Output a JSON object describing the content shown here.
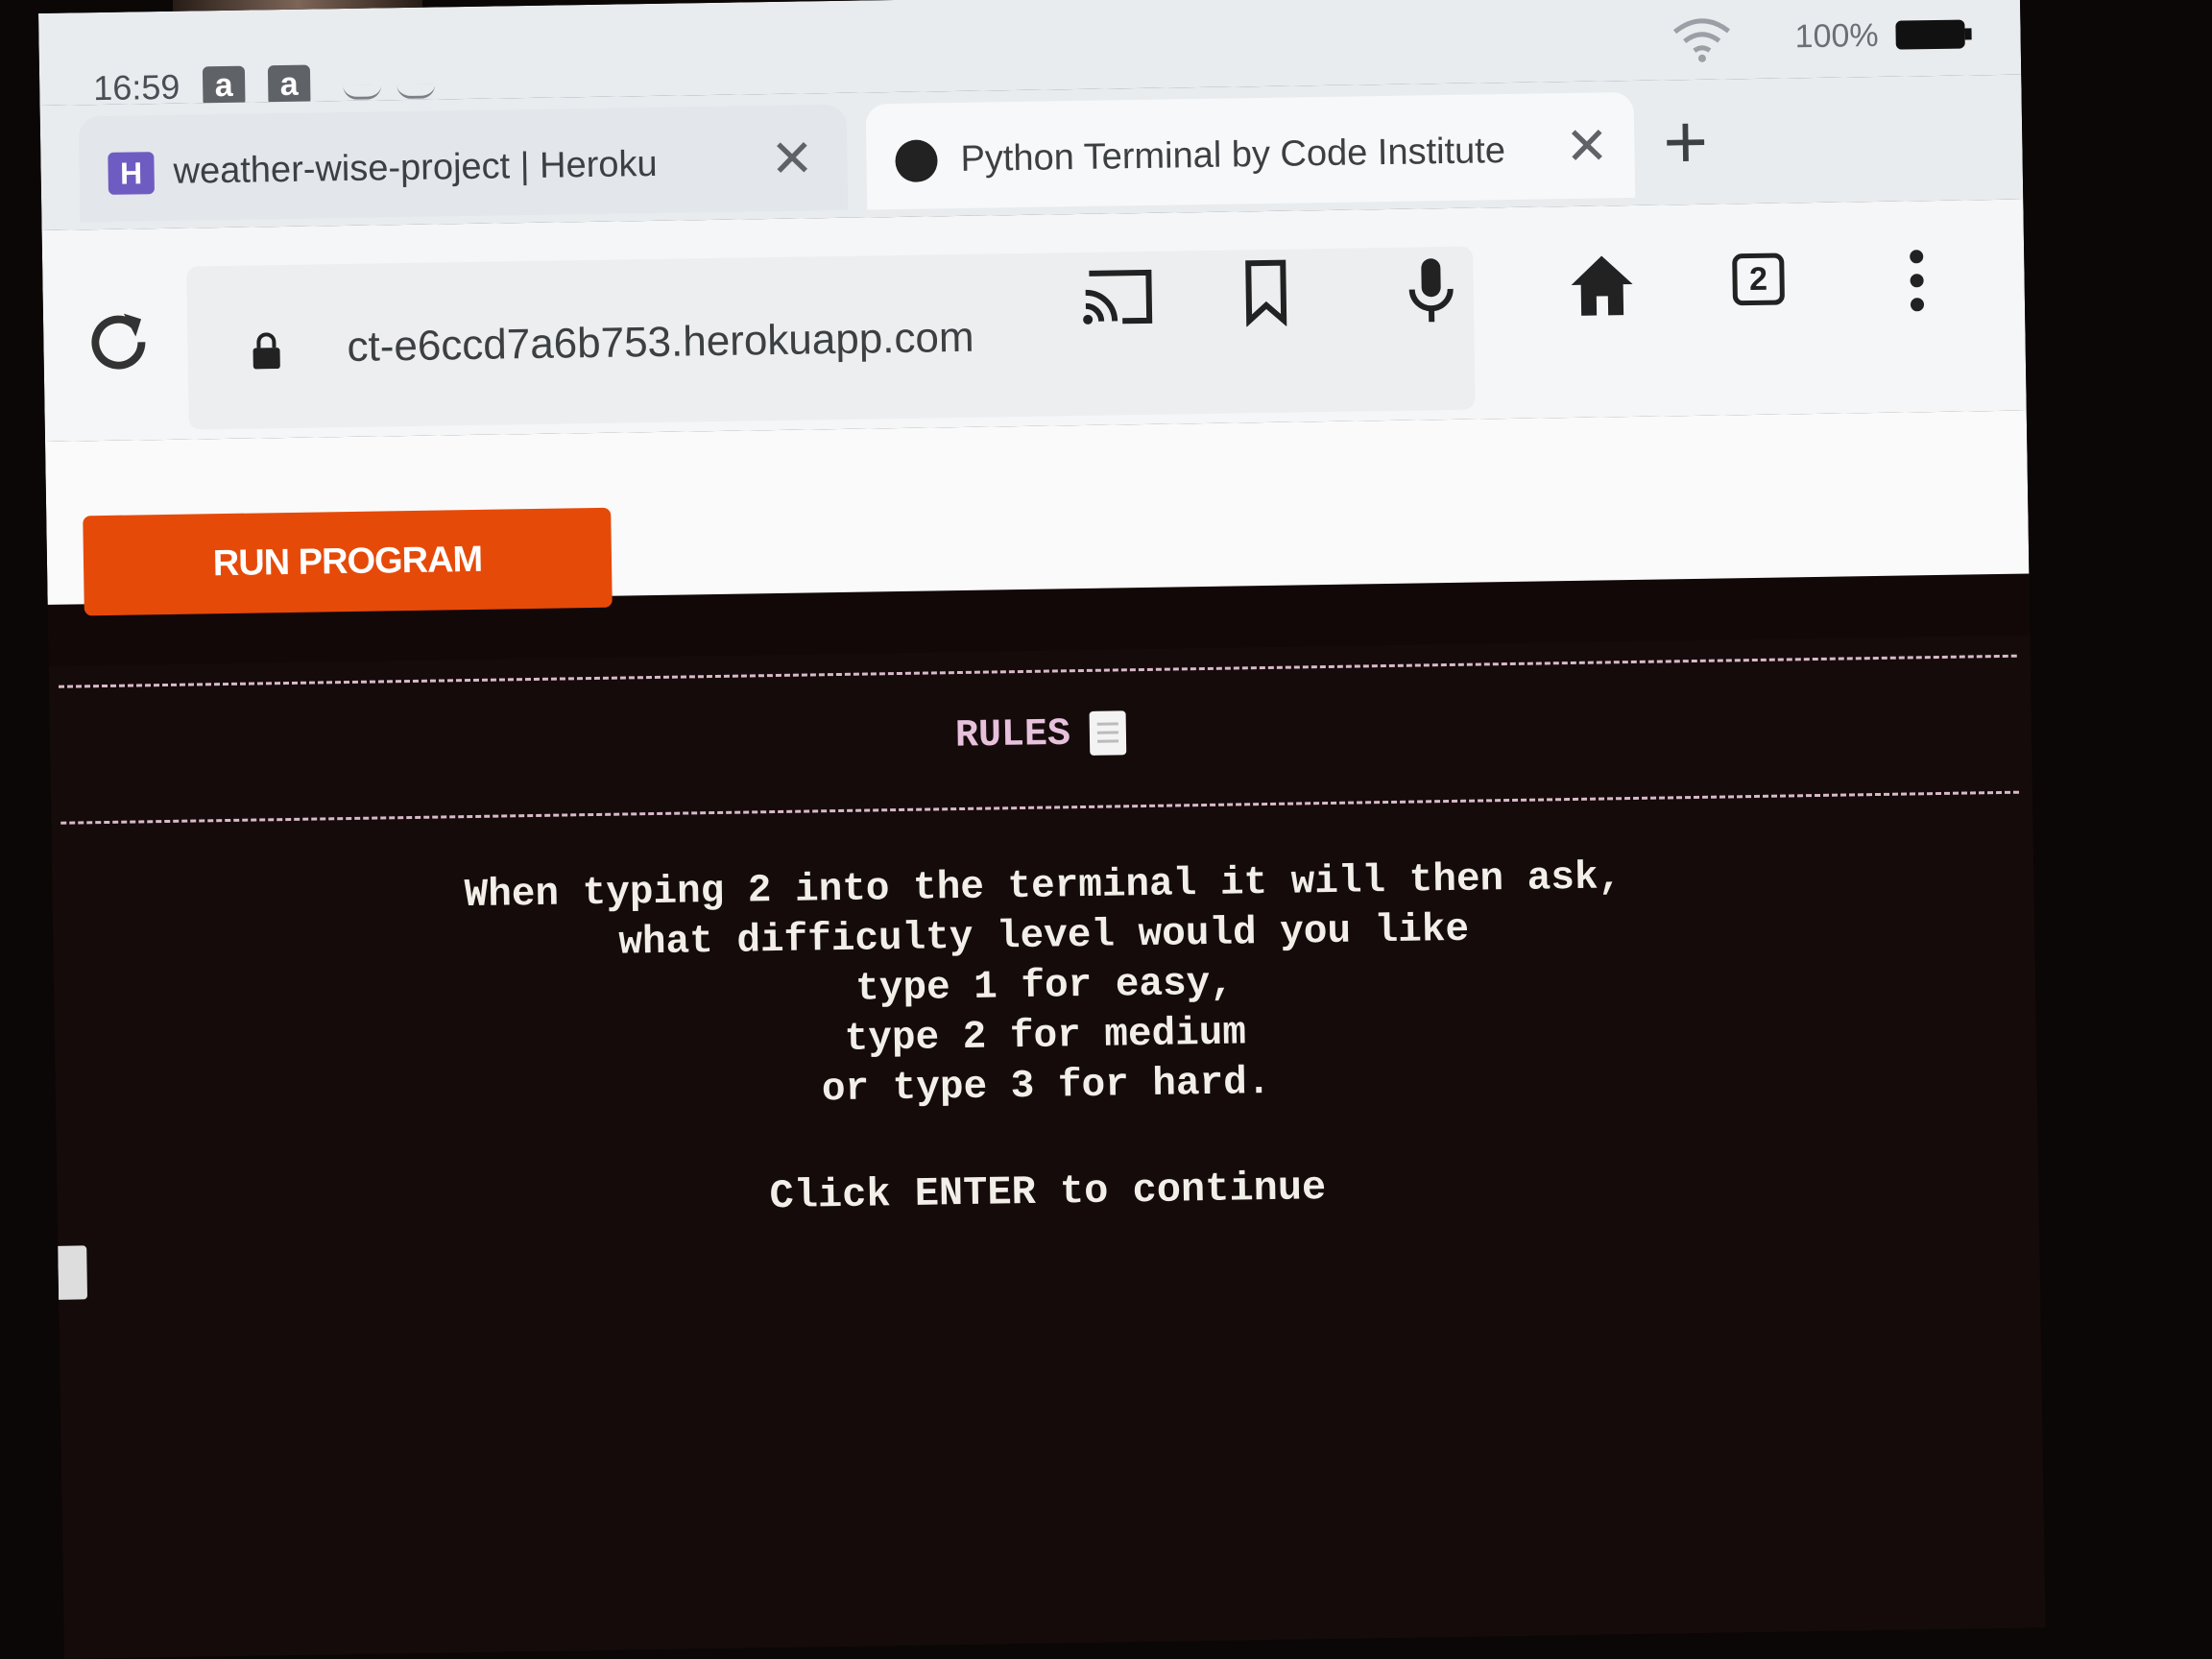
{
  "status_bar": {
    "time": "16:59",
    "battery": "100%",
    "icons": [
      "amazon-icon",
      "amazon-icon",
      "wifi-icon",
      "battery-icon"
    ]
  },
  "tabs": [
    {
      "title": "weather-wise-project | Heroku",
      "favicon": "heroku-icon"
    },
    {
      "title": "Python Terminal by Code Institute",
      "favicon": "globe-icon"
    }
  ],
  "toolbar": {
    "url": "ct-e6ccd7a6b753.herokuapp.com",
    "tab_count": "2"
  },
  "page": {
    "run_button": "RUN PROGRAM"
  },
  "terminal": {
    "heading": "RULES",
    "lines": [
      "When typing 2 into the terminal it will then ask,",
      "what difficulty level would you like",
      "type 1 for easy,",
      "type 2 for medium",
      "or type 3 for hard."
    ],
    "prompt": "Click ENTER to continue"
  },
  "colors": {
    "run_button": "#e64a09",
    "terminal_bg": "#140b0a",
    "heading": "#e7c1dc"
  }
}
